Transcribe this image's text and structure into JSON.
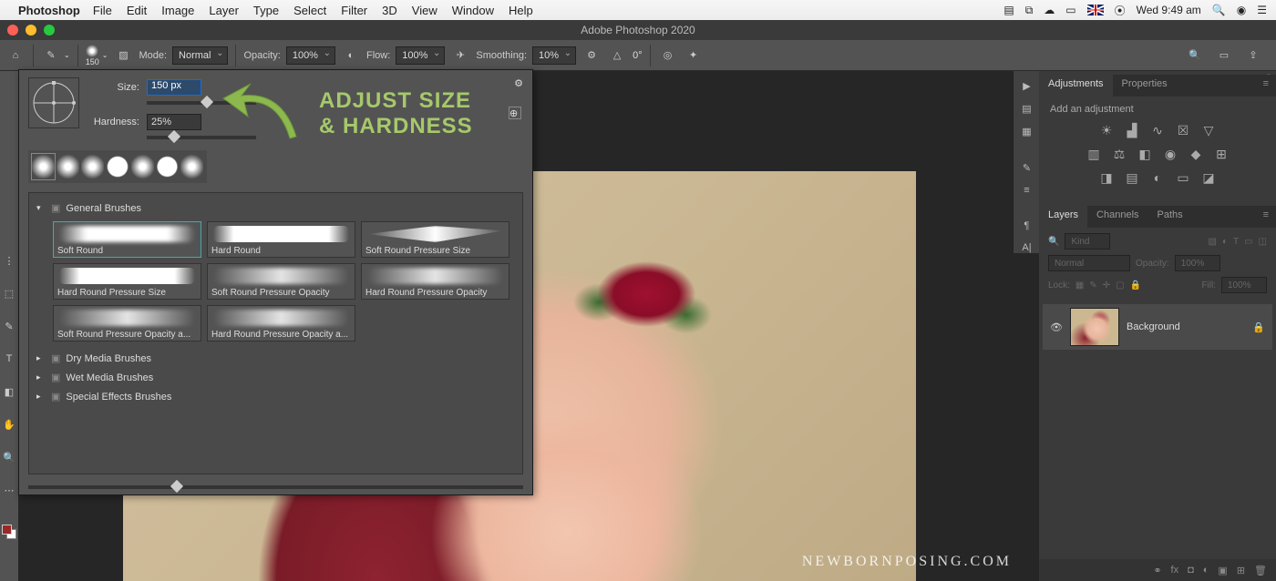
{
  "menubar": {
    "app": "Photoshop",
    "items": [
      "File",
      "Edit",
      "Image",
      "Layer",
      "Type",
      "Select",
      "Filter",
      "3D",
      "View",
      "Window",
      "Help"
    ],
    "clock": "Wed 9:49 am"
  },
  "titlebar": {
    "title": "Adobe Photoshop 2020"
  },
  "optbar": {
    "brush_size_display": "150",
    "mode_label": "Mode:",
    "mode_value": "Normal",
    "opacity_label": "Opacity:",
    "opacity_value": "100%",
    "flow_label": "Flow:",
    "flow_value": "100%",
    "smoothing_label": "Smoothing:",
    "smoothing_value": "10%",
    "angle_value": "0°"
  },
  "brushpanel": {
    "size_label": "Size:",
    "size_value": "150 px",
    "hardness_label": "Hardness:",
    "hardness_value": "25%",
    "folders": {
      "general": "General Brushes",
      "dry": "Dry Media Brushes",
      "wet": "Wet Media Brushes",
      "sfx": "Special Effects Brushes"
    },
    "brushes": [
      "Soft Round",
      "Hard Round",
      "Soft Round Pressure Size",
      "Hard Round Pressure Size",
      "Soft Round Pressure Opacity",
      "Hard Round Pressure Opacity",
      "Soft Round Pressure Opacity a...",
      "Hard Round Pressure Opacity a..."
    ]
  },
  "annotation": {
    "line1": "ADJUST SIZE",
    "line2": "& HARDNESS"
  },
  "rpanel": {
    "adjustments_tab": "Adjustments",
    "properties_tab": "Properties",
    "add_adjustment": "Add an adjustment",
    "layers_tab": "Layers",
    "channels_tab": "Channels",
    "paths_tab": "Paths",
    "kind": "Kind",
    "blend": "Normal",
    "opacity_label": "Opacity:",
    "opacity_value": "100%",
    "lock_label": "Lock:",
    "fill_label": "Fill:",
    "fill_value": "100%",
    "layer_name": "Background"
  },
  "watermark": "NEWBORNPOSING.COM"
}
